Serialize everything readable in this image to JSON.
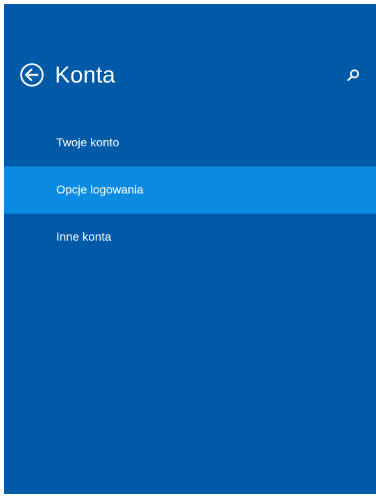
{
  "header": {
    "title": "Konta",
    "back_icon": "back-arrow-circle-icon",
    "search_icon": "search-icon"
  },
  "nav": {
    "items": [
      {
        "label": "Twoje konto",
        "selected": false
      },
      {
        "label": "Opcje logowania",
        "selected": true
      },
      {
        "label": "Inne konta",
        "selected": false
      }
    ]
  },
  "colors": {
    "background": "#005aa7",
    "selected_item": "#0a8ae0",
    "text": "#ffffff"
  }
}
